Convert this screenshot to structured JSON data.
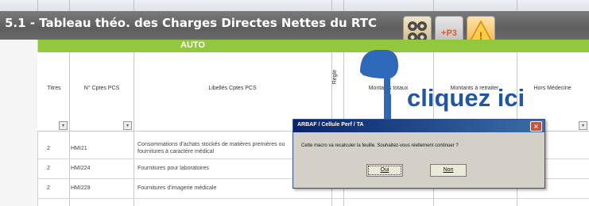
{
  "sheet": {
    "title": "5.1 - Tableau théo. des Charges Directes Nettes du RTC",
    "section_label": "AUTO",
    "column_headers": [
      "Titres",
      "N° Cptes PCS",
      "Libellés Cptes PCS",
      "Règle",
      "Montants totaux",
      "Montants à retraiter",
      "Hors Médecine"
    ],
    "filter_glyph": "▾",
    "rows": [
      {
        "titre": "2",
        "compte": "HMI21",
        "libelle": "Consommations d'achats stockés de matières premières ou fournitures à caractère médical"
      },
      {
        "titre": "2",
        "compte": "HMI224",
        "libelle": "Fournitures pour laboratoires"
      },
      {
        "titre": "2",
        "compte": "HMI229",
        "libelle": "Fournitures d'imagerie médicale"
      }
    ]
  },
  "toolbar": {
    "btn_b_label": "+P3",
    "btn_c_label": "!"
  },
  "overlay": {
    "callout_text": "cliquez ici"
  },
  "dialog": {
    "title": "ARBAF / Cellule Perf / TA",
    "message": "Cette macro va recalculer la feuille. Souhaitez-vous réellement continuer ?",
    "yes_label": "Oui",
    "no_label": "Non",
    "close_glyph": "×"
  },
  "colors": {
    "title_bar": "#6b6b6b",
    "auto_band": "#92c83e",
    "callout_blue": "#1f56a8",
    "dialog_title": "#0a246a"
  }
}
